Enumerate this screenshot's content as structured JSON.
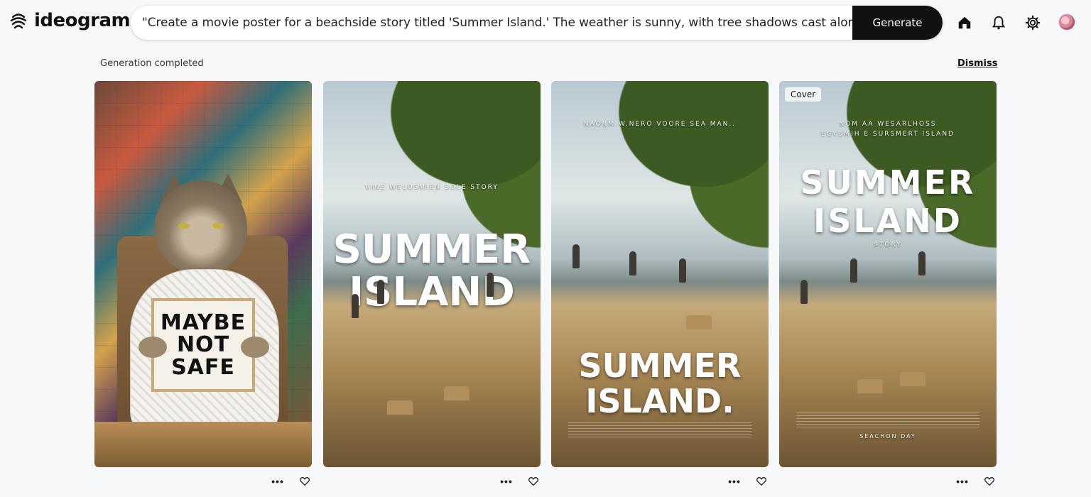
{
  "app": {
    "name": "ideogram"
  },
  "header": {
    "prompt_value": "\"Create a movie poster for a beachside story titled 'Summer Island.' The weather is sunny, with tree shadows cast along the",
    "generate_label": "Generate",
    "icons": [
      "home-icon",
      "bell-icon",
      "gear-icon",
      "avatar"
    ]
  },
  "status": {
    "text": "Generation completed",
    "dismiss_label": "Dismiss"
  },
  "cards": [
    {
      "sign_line1": "MAYBE",
      "sign_line2": "NOT",
      "sign_line3": "SAFE"
    },
    {
      "title_line1": "SUMMER",
      "title_line2": "ISLAND",
      "tagline": "VINE WELOSMIEN SOLE STORY"
    },
    {
      "title_line1": "SUMMER",
      "title_line2": "ISLAND.",
      "tagline": "NAONM W.NERO VOORE SEA MAN.."
    },
    {
      "badge": "Cover",
      "title_line1": "SUMMER",
      "title_line2": "ISLAND",
      "tagline": "NOM AA WESARLHOSS",
      "tagline2": "EGYUMIH E SURSMERT ISLAND",
      "sub": "STORY",
      "footer": "SEACHON DAY"
    }
  ],
  "colors": {
    "accent": "#111111",
    "background": "#f7f8fa"
  }
}
